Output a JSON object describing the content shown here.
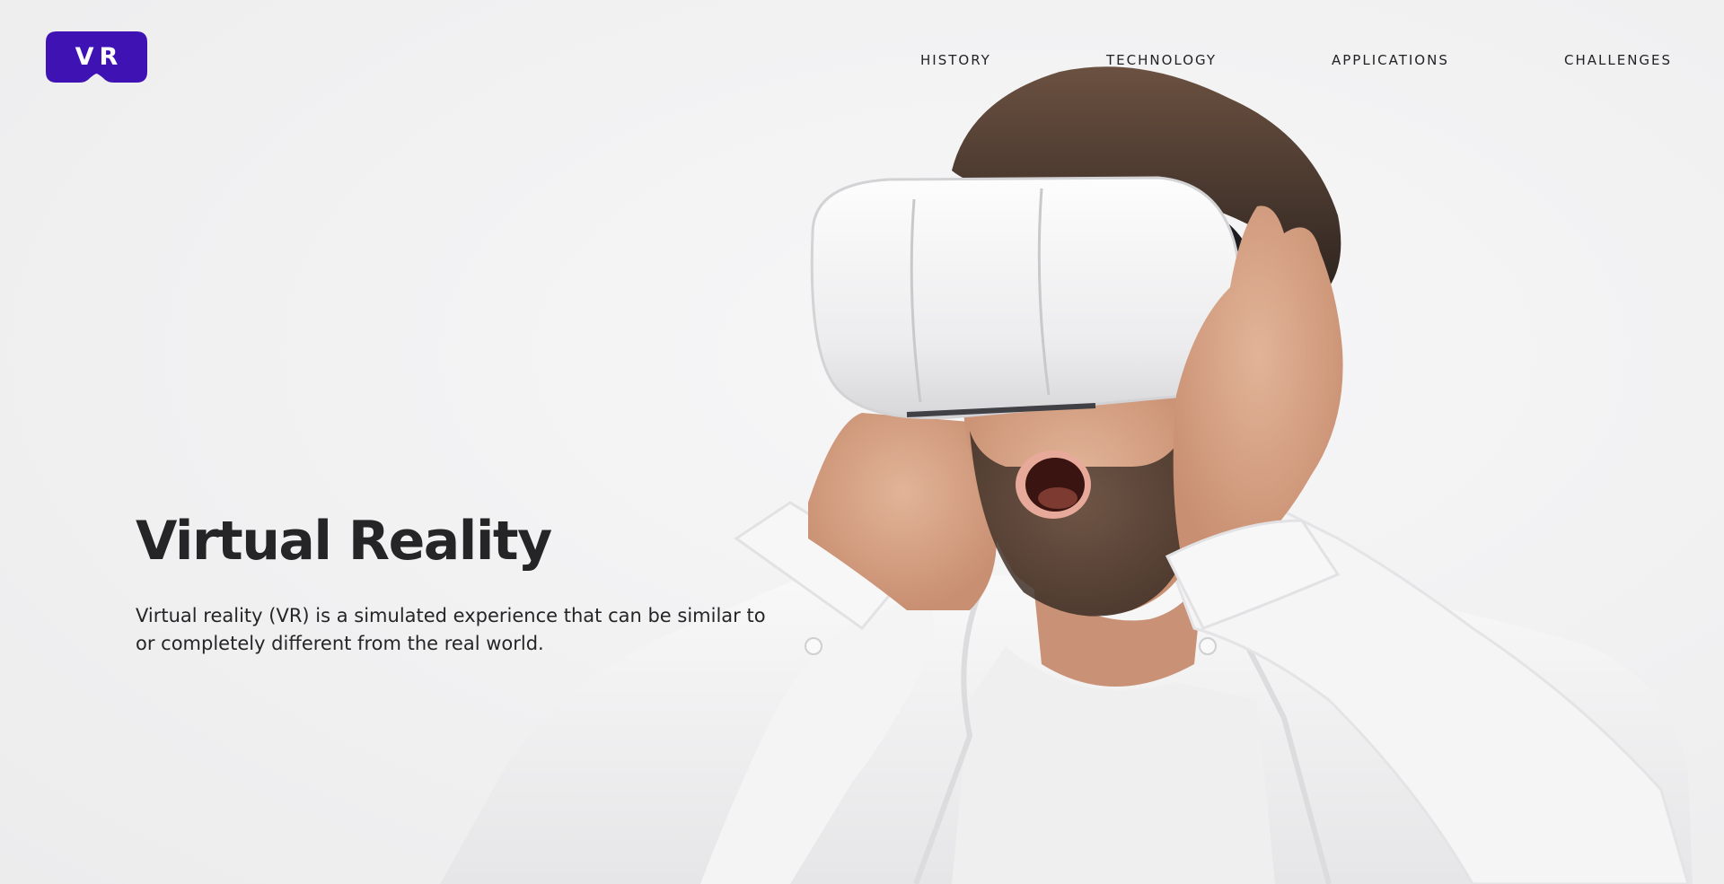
{
  "logo": {
    "text": "VR",
    "color": "#3f12b3"
  },
  "nav": {
    "items": [
      {
        "label": "HISTORY"
      },
      {
        "label": "TECHNOLOGY"
      },
      {
        "label": "APPLICATIONS"
      },
      {
        "label": "CHALLENGES"
      }
    ]
  },
  "hero": {
    "title": "Virtual Reality",
    "description": "Virtual reality (VR) is a simulated experience that can be similar to or completely different from the real world."
  },
  "image": {
    "subject": "man-wearing-vr-headset"
  },
  "colors": {
    "brand": "#3f12b3",
    "text": "#252528",
    "background": "#f3f3f4"
  }
}
